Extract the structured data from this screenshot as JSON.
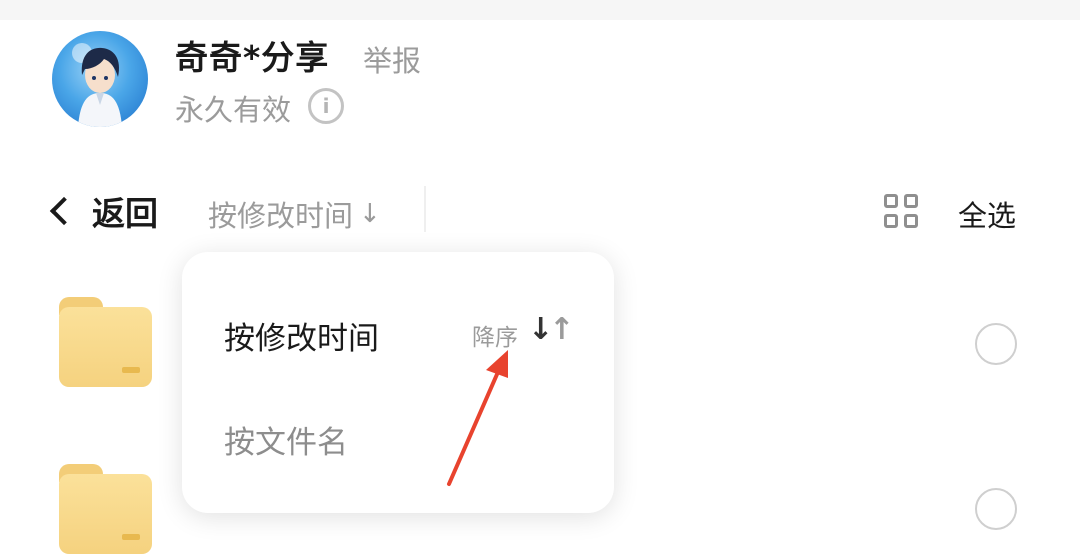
{
  "share": {
    "owner_name": "奇奇*分享",
    "report_label": "举报",
    "validity": "永久有效",
    "info_glyph": "i"
  },
  "toolbar": {
    "back_label": "返回",
    "sort_label": "按修改时间",
    "sort_arrow": "↓",
    "select_all_label": "全选"
  },
  "sort_menu": {
    "items": [
      {
        "label": "按修改时间",
        "selected": true
      },
      {
        "label": "按文件名",
        "selected": false
      }
    ],
    "order_label": "降序",
    "order_down_glyph": "↓",
    "order_up_glyph": "↑"
  },
  "icons": {
    "avatar": "anime-avatar",
    "info": "info-icon",
    "back": "chevron-left-icon",
    "grid": "grid-view-icon",
    "folder": "folder-icon",
    "radio": "radio-circle-icon",
    "annotation": "red-arrow-annotation"
  },
  "colors": {
    "primary_text": "#1a1a1a",
    "secondary_text": "#9b9b9b",
    "folder": "#f5d27f",
    "annotation_arrow": "#e8432e"
  }
}
